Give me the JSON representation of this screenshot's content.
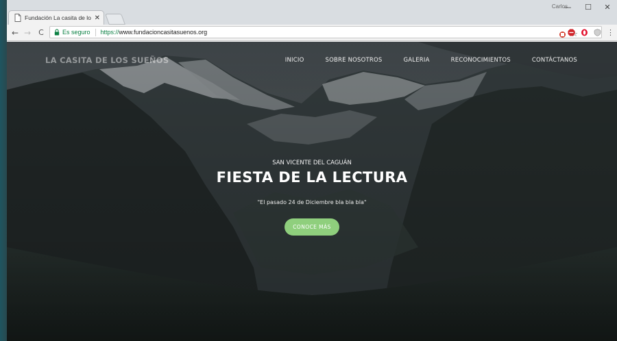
{
  "browser": {
    "tab_title": "Fundación La casita de lo",
    "tab_close": "✕",
    "user_name": "Carlos",
    "window_controls": {
      "minimize": "—",
      "maximize": "☐",
      "close": "✕"
    },
    "nav": {
      "back": "←",
      "forward": "→",
      "reload": "C"
    },
    "secure_label": "Es seguro",
    "url_scheme": "https://",
    "url_host": "www.fundacioncasitasuenos.org",
    "bookmark": "☆",
    "menu": "⋮"
  },
  "site": {
    "brand": "LA CASITA DE LOS SUEÑOS",
    "nav": [
      {
        "label": "INICIO"
      },
      {
        "label": "SOBRE NOSOTROS"
      },
      {
        "label": "GALERIA"
      },
      {
        "label": "RECONOCIMIENTOS"
      },
      {
        "label": "CONTÁCTANOS"
      }
    ],
    "hero": {
      "subtitle": "SAN VICENTE DEL CAGUÁN",
      "title": "FIESTA DE LA LECTURA",
      "quote": "\"El pasado 24 de Diciembre bla bla bla\"",
      "cta": "CONOCE MÁS"
    }
  },
  "colors": {
    "secure_green": "#0b8043",
    "cta_green": "#8fcf7d",
    "abp_red": "#d1262c",
    "opera_red": "#e3102d"
  }
}
